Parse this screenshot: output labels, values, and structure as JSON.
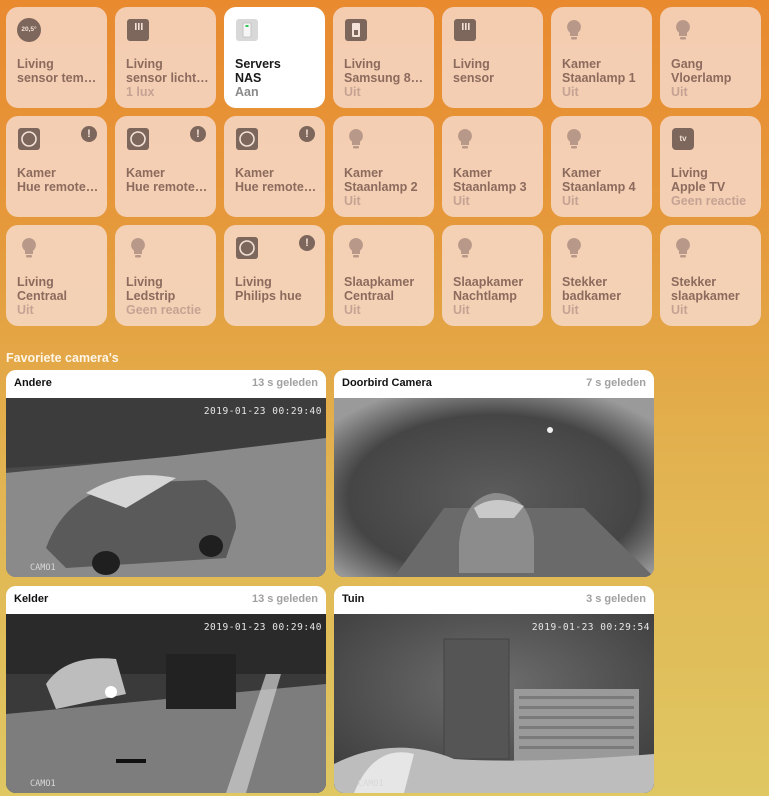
{
  "tiles": [
    {
      "line1": "Living",
      "line2": "sensor tem…",
      "status": "",
      "icon": "temperature-sensor-icon",
      "badge": "20,5°"
    },
    {
      "line1": "Living",
      "line2": "sensor licht…",
      "status": "1 lux",
      "icon": "light-sensor-icon"
    },
    {
      "line1": "Servers",
      "line2": "NAS",
      "status": "Aan",
      "icon": "outlet-icon",
      "active": true
    },
    {
      "line1": "Living",
      "line2": "Samsung 8…",
      "status": "Uit",
      "icon": "switch-icon"
    },
    {
      "line1": "Living",
      "line2": "sensor",
      "status": "",
      "icon": "light-sensor-icon"
    },
    {
      "line1": "Kamer",
      "line2": "Staanlamp 1",
      "status": "Uit",
      "icon": "bulb-icon"
    },
    {
      "line1": "Gang",
      "line2": "Vloerlamp",
      "status": "Uit",
      "icon": "bulb-icon"
    },
    {
      "line1": "Kamer",
      "line2": "Hue remote…",
      "status": "",
      "icon": "remote-icon",
      "alert": "!"
    },
    {
      "line1": "Kamer",
      "line2": "Hue remote…",
      "status": "",
      "icon": "remote-icon",
      "alert": "!"
    },
    {
      "line1": "Kamer",
      "line2": "Hue remote…",
      "status": "",
      "icon": "remote-icon",
      "alert": "!"
    },
    {
      "line1": "Kamer",
      "line2": "Staanlamp 2",
      "status": "Uit",
      "icon": "bulb-icon"
    },
    {
      "line1": "Kamer",
      "line2": "Staanlamp 3",
      "status": "Uit",
      "icon": "bulb-icon"
    },
    {
      "line1": "Kamer",
      "line2": "Staanlamp 4",
      "status": "Uit",
      "icon": "bulb-icon"
    },
    {
      "line1": "Living",
      "line2": "Apple TV",
      "status": "Geen reactie",
      "icon": "apple-tv-icon",
      "badge": "tv"
    },
    {
      "line1": "Living",
      "line2": "Centraal",
      "status": "Uit",
      "icon": "bulb-icon"
    },
    {
      "line1": "Living",
      "line2": "Ledstrip",
      "status": "Geen reactie",
      "icon": "bulb-icon"
    },
    {
      "line1": "Living",
      "line2": "Philips hue",
      "status": "",
      "icon": "remote-icon",
      "alert": "!"
    },
    {
      "line1": "Slaapkamer",
      "line2": "Centraal",
      "status": "Uit",
      "icon": "bulb-icon"
    },
    {
      "line1": "Slaapkamer",
      "line2": "Nachtlamp",
      "status": "Uit",
      "icon": "bulb-icon"
    },
    {
      "line1": "Stekker",
      "line2": "badkamer",
      "status": "Uit",
      "icon": "bulb-icon"
    },
    {
      "line1": "Stekker",
      "line2": "slaapkamer",
      "status": "Uit",
      "icon": "bulb-icon"
    }
  ],
  "cameras_title": "Favoriete camera's",
  "cameras": [
    {
      "name": "Andere",
      "time": "13 s geleden",
      "timestamp": "2019-01-23 00:29:40",
      "label": "CAMO1"
    },
    {
      "name": "Doorbird Camera",
      "time": "7 s geleden",
      "timestamp": "",
      "label": ""
    },
    {
      "name": "Kelder",
      "time": "13 s geleden",
      "timestamp": "2019-01-23 00:29:40",
      "label": "CAMO1"
    },
    {
      "name": "Tuin",
      "time": "3 s geleden",
      "timestamp": "2019-01-23 00:29:54",
      "label": "CAMO1"
    }
  ]
}
